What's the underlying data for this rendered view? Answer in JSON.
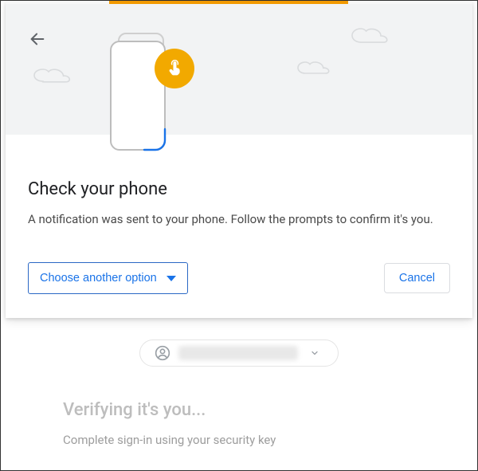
{
  "modal": {
    "title": "Check your phone",
    "description": "A notification was sent to your phone. Follow the prompts to confirm it's you.",
    "choose_label": "Choose another option",
    "cancel_label": "Cancel"
  },
  "background": {
    "heading": "Verifying it's you...",
    "subheading": "Complete sign-in using your security key"
  },
  "colors": {
    "accent_orange": "#f29900",
    "link_blue": "#1a73e8"
  }
}
